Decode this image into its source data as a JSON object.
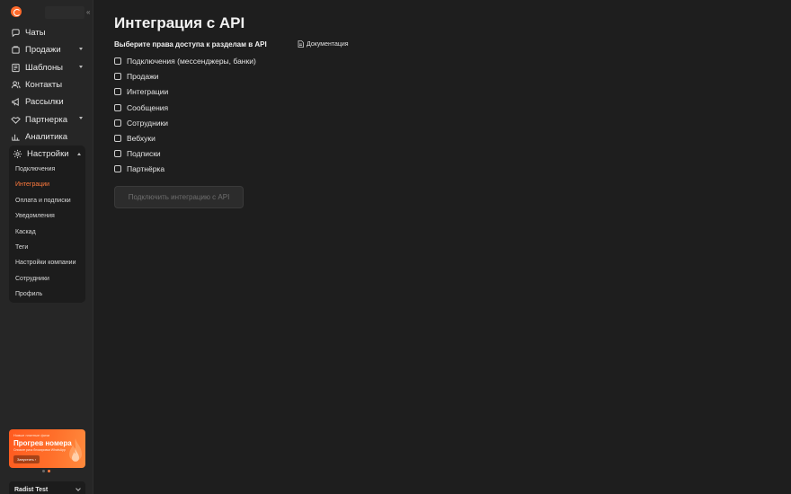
{
  "sidebar": {
    "collapse_icon": "collapse-icon",
    "nav": [
      {
        "label": "Чаты",
        "icon": "chat-icon",
        "has_caret": false
      },
      {
        "label": "Продажи",
        "icon": "cart-icon",
        "has_caret": true
      },
      {
        "label": "Шаблоны",
        "icon": "template-icon",
        "has_caret": true
      },
      {
        "label": "Контакты",
        "icon": "contacts-icon",
        "has_caret": false
      },
      {
        "label": "Рассылки",
        "icon": "megaphone-icon",
        "has_caret": false
      },
      {
        "label": "Партнерка",
        "icon": "handshake-icon",
        "has_caret": true
      },
      {
        "label": "Аналитика",
        "icon": "analytics-icon",
        "has_caret": false
      }
    ],
    "settings": {
      "label": "Настройки",
      "icon": "gear-icon",
      "items": [
        {
          "label": "Подключения",
          "active": false
        },
        {
          "label": "Интеграции",
          "active": true
        },
        {
          "label": "Оплата и подписки",
          "active": false
        },
        {
          "label": "Уведомления",
          "active": false
        },
        {
          "label": "Каскад",
          "active": false
        },
        {
          "label": "Теги",
          "active": false
        },
        {
          "label": "Настройки компании",
          "active": false
        },
        {
          "label": "Сотрудники",
          "active": false
        },
        {
          "label": "Профиль",
          "active": false
        }
      ]
    },
    "promo": {
      "tag": "Новые платные фичи",
      "title": "Прогрев номера",
      "subtitle": "Снизьте риск блокировки WhatsApp",
      "button": "Запустить"
    },
    "account": {
      "name": "Radist Test"
    }
  },
  "main": {
    "title": "Интеграция с API",
    "section_label": "Выберите права доступа к разделам в API",
    "doc_link": "Документация",
    "permissions": [
      {
        "label": "Подключения (мессенджеры, банки)",
        "checked": false
      },
      {
        "label": "Продажи",
        "checked": false
      },
      {
        "label": "Интеграции",
        "checked": false
      },
      {
        "label": "Сообщения",
        "checked": false
      },
      {
        "label": "Сотрудники",
        "checked": false
      },
      {
        "label": "Вебхуки",
        "checked": false
      },
      {
        "label": "Подписки",
        "checked": false
      },
      {
        "label": "Партнёрка",
        "checked": false
      }
    ],
    "connect_button": "Подключить интеграцию с API"
  },
  "colors": {
    "accent": "#ff6a2b",
    "background": "#1e1e1e",
    "sidebar": "#262626"
  }
}
